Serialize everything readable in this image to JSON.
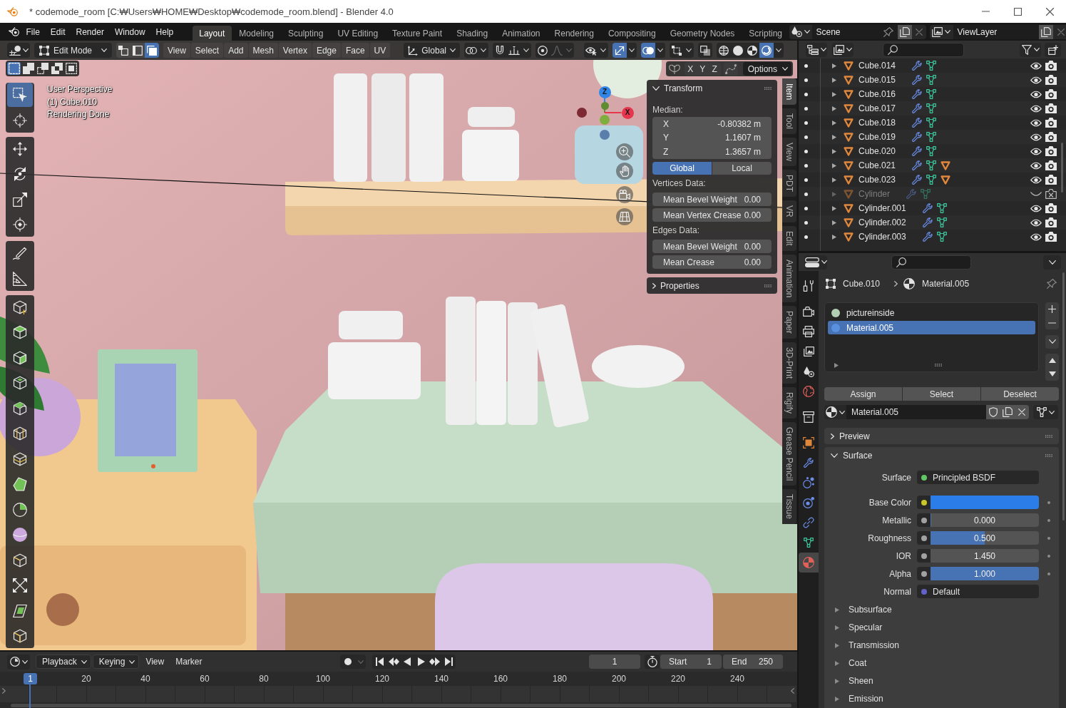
{
  "window": {
    "title": "* codemode_room [C:₩Users₩HOME₩Desktop₩codemode_room.blend] - Blender 4.0"
  },
  "menu_bar": {
    "menus": [
      "File",
      "Edit",
      "Render",
      "Window",
      "Help"
    ]
  },
  "workspace_tabs": [
    {
      "label": "Layout",
      "selected": true
    },
    {
      "label": "Modeling",
      "selected": false
    },
    {
      "label": "Sculpting",
      "selected": false
    },
    {
      "label": "UV Editing",
      "selected": false
    },
    {
      "label": "Texture Paint",
      "selected": false
    },
    {
      "label": "Shading",
      "selected": false
    },
    {
      "label": "Animation",
      "selected": false
    },
    {
      "label": "Rendering",
      "selected": false
    },
    {
      "label": "Compositing",
      "selected": false
    },
    {
      "label": "Geometry Nodes",
      "selected": false
    },
    {
      "label": "Scripting",
      "selected": false
    }
  ],
  "scene_selector": {
    "value": "Scene"
  },
  "view_layer_selector": {
    "value": "ViewLayer"
  },
  "viewport_header": {
    "mode": "Edit Mode",
    "select_modes": [
      {
        "kind": "vertex",
        "selected": false
      },
      {
        "kind": "edge",
        "selected": false
      },
      {
        "kind": "face",
        "selected": true
      }
    ],
    "menus": [
      "View",
      "Select",
      "Add",
      "Mesh",
      "Vertex",
      "Edge",
      "Face",
      "UV"
    ],
    "orientation": "Global",
    "toggle_groups": [
      [
        {
          "kind": "pivot",
          "on": false,
          "dropdown": true,
          "disabled": false
        }
      ],
      [
        {
          "kind": "snap",
          "on": false,
          "dropdown": false,
          "disabled": false
        },
        {
          "kind": "snap_target",
          "on": false,
          "dropdown": true,
          "disabled": false
        }
      ],
      [
        {
          "kind": "proportional",
          "on": false,
          "dropdown": false,
          "disabled": false
        },
        {
          "kind": "falloff",
          "on": false,
          "dropdown": true,
          "disabled": true
        }
      ],
      [
        {
          "kind": "selectability",
          "on": false,
          "dropdown": true,
          "disabled": false
        }
      ],
      [
        {
          "kind": "gizmos",
          "on": true,
          "dropdown": true,
          "disabled": false
        }
      ],
      [
        {
          "kind": "overlays",
          "on": true,
          "dropdown": true,
          "disabled": false
        }
      ],
      [
        {
          "kind": "mesh_overlays",
          "on": false,
          "dropdown": true,
          "disabled": false
        }
      ],
      [
        {
          "kind": "xray",
          "on": false,
          "dropdown": false,
          "disabled": false
        }
      ],
      [
        {
          "kind": "wireframe",
          "on": false,
          "dropdown": false,
          "disabled": false
        },
        {
          "kind": "solid",
          "on": false,
          "dropdown": false,
          "disabled": false
        },
        {
          "kind": "material_preview",
          "on": false,
          "dropdown": false,
          "disabled": false
        },
        {
          "kind": "rendered",
          "on": true,
          "dropdown": true,
          "disabled": false
        }
      ]
    ]
  },
  "tool_header": {
    "select_box_modes": [
      {
        "kind": "set",
        "selected": true
      },
      {
        "kind": "extend",
        "selected": false
      },
      {
        "kind": "subtract",
        "selected": false
      },
      {
        "kind": "difference",
        "selected": false
      },
      {
        "kind": "intersect",
        "selected": false
      }
    ],
    "mirror_axes": [
      {
        "label": "X",
        "on": false
      },
      {
        "label": "Y",
        "on": false
      },
      {
        "label": "Z",
        "on": false
      }
    ],
    "options": "Options"
  },
  "viewport_info": [
    "User Perspective",
    "(1) Cube.010",
    "Rendering Done"
  ],
  "toolbar": {
    "groups": [
      [
        {
          "kind": "select_box",
          "selected": true
        },
        {
          "kind": "cursor",
          "selected": false
        }
      ],
      [
        {
          "kind": "move",
          "selected": false
        },
        {
          "kind": "rotate",
          "selected": false
        },
        {
          "kind": "scale",
          "selected": false
        },
        {
          "kind": "transform",
          "selected": false
        }
      ],
      [
        {
          "kind": "annotate",
          "selected": false
        },
        {
          "kind": "measure",
          "selected": false
        }
      ],
      [
        {
          "kind": "add_cube",
          "selected": false
        },
        {
          "kind": "extrude_region",
          "selected": false
        },
        {
          "kind": "extrude_manifold",
          "selected": false
        },
        {
          "kind": "inset",
          "selected": false
        },
        {
          "kind": "bevel",
          "selected": false
        },
        {
          "kind": "loop_cut",
          "selected": false
        },
        {
          "kind": "knife",
          "selected": false
        },
        {
          "kind": "poly_build",
          "selected": false
        },
        {
          "kind": "spin",
          "selected": false
        },
        {
          "kind": "smooth",
          "selected": false
        },
        {
          "kind": "edge_slide",
          "selected": false
        },
        {
          "kind": "shrink_fatten",
          "selected": false
        },
        {
          "kind": "shear",
          "selected": false
        },
        {
          "kind": "rip_region",
          "selected": false
        }
      ]
    ]
  },
  "nav_gizmo": {
    "axes": [
      {
        "kind": "pos_z",
        "label": "Z",
        "color": "#2f86e6"
      },
      {
        "kind": "pos_y",
        "color": "#5f8c30"
      },
      {
        "kind": "pos_x",
        "label": "X",
        "color": "#e5364e"
      },
      {
        "kind": "neg_x",
        "color": "#7d2a35"
      },
      {
        "kind": "neg_y",
        "color": "#7fae3e"
      },
      {
        "kind": "neg_z",
        "color": "#5a7fab"
      }
    ],
    "buttons": [
      {
        "kind": "zoom"
      },
      {
        "kind": "pan"
      },
      {
        "kind": "camera"
      },
      {
        "kind": "ortho"
      }
    ]
  },
  "sidebar": {
    "panels": [
      {
        "title": "Transform",
        "expanded": true,
        "rows": [
          {
            "kind": "heading",
            "text": "Median:"
          },
          {
            "kind": "vector_component",
            "label": "X",
            "value": "-0.80382 m"
          },
          {
            "kind": "vector_component",
            "label": "Y",
            "value": "1.1607 m"
          },
          {
            "kind": "vector_component",
            "label": "Z",
            "value": "1.3657 m"
          },
          {
            "kind": "toggle",
            "options": [
              {
                "label": "Global",
                "selected": true
              },
              {
                "label": "Local",
                "selected": false
              }
            ]
          },
          {
            "kind": "heading",
            "text": "Vertices Data:"
          },
          {
            "kind": "value",
            "label": "Mean Bevel Weight",
            "value": "0.00"
          },
          {
            "kind": "value",
            "label": "Mean Vertex Crease",
            "value": "0.00"
          },
          {
            "kind": "heading",
            "text": "Edges Data:"
          },
          {
            "kind": "value",
            "label": "Mean Bevel Weight",
            "value": "0.00"
          },
          {
            "kind": "value",
            "label": "Mean Crease",
            "value": "0.00"
          }
        ]
      },
      {
        "title": "Properties",
        "expanded": false
      }
    ],
    "tabs": [
      {
        "label": "Item",
        "selected": true
      },
      {
        "label": "Tool",
        "selected": false
      },
      {
        "label": "View",
        "selected": false
      },
      {
        "label": "PDT",
        "selected": false
      },
      {
        "label": "VR",
        "selected": false
      },
      {
        "label": "Edit",
        "selected": false
      },
      {
        "label": "Animation",
        "selected": false
      },
      {
        "label": "Paper",
        "selected": false
      },
      {
        "label": "3D-Print",
        "selected": false
      },
      {
        "label": "Rigify",
        "selected": false
      },
      {
        "label": "Grease Pencil",
        "selected": false
      },
      {
        "label": "Tissue",
        "selected": false
      }
    ]
  },
  "outliner": {
    "rows": [
      {
        "name": "Cube.014",
        "visible": true,
        "renderable": true,
        "child_object": false
      },
      {
        "name": "Cube.015",
        "visible": true,
        "renderable": true,
        "child_object": false
      },
      {
        "name": "Cube.016",
        "visible": true,
        "renderable": true,
        "child_object": false
      },
      {
        "name": "Cube.017",
        "visible": true,
        "renderable": true,
        "child_object": false
      },
      {
        "name": "Cube.018",
        "visible": true,
        "renderable": true,
        "child_object": false
      },
      {
        "name": "Cube.019",
        "visible": true,
        "renderable": true,
        "child_object": false
      },
      {
        "name": "Cube.020",
        "visible": true,
        "renderable": true,
        "child_object": false
      },
      {
        "name": "Cube.021",
        "visible": true,
        "renderable": true,
        "child_object": true
      },
      {
        "name": "Cube.023",
        "visible": true,
        "renderable": true,
        "child_object": true
      },
      {
        "name": "Cylinder",
        "visible": false,
        "renderable": false,
        "child_object": false
      },
      {
        "name": "Cylinder.001",
        "visible": true,
        "renderable": true,
        "child_object": false
      },
      {
        "name": "Cylinder.002",
        "visible": true,
        "renderable": true,
        "child_object": false
      },
      {
        "name": "Cylinder.003",
        "visible": true,
        "renderable": true,
        "child_object": false
      }
    ]
  },
  "properties": {
    "tab_groups": [
      [
        {
          "kind": "tool",
          "selected": false
        }
      ],
      [
        {
          "kind": "render",
          "selected": false
        },
        {
          "kind": "output",
          "selected": false
        },
        {
          "kind": "view_layer",
          "selected": false
        },
        {
          "kind": "scene",
          "selected": false
        },
        {
          "kind": "world",
          "selected": false
        }
      ],
      [
        {
          "kind": "collection",
          "selected": false
        }
      ],
      [
        {
          "kind": "object",
          "selected": false
        },
        {
          "kind": "modifiers",
          "selected": false
        },
        {
          "kind": "particles",
          "selected": false
        },
        {
          "kind": "physics",
          "selected": false
        },
        {
          "kind": "constraints",
          "selected": false
        },
        {
          "kind": "data",
          "selected": false
        },
        {
          "kind": "material",
          "selected": true
        }
      ]
    ],
    "breadcrumb": {
      "object": "Cube.010",
      "material": "Material.005"
    },
    "material_slots": [
      {
        "name": "pictureinside",
        "color": "#b4d0b4",
        "selected": false
      },
      {
        "name": "Material.005",
        "color": "#5a90e0",
        "selected": true
      }
    ],
    "slot_actions": [
      "Assign",
      "Select",
      "Deselect"
    ],
    "material_name": "Material.005",
    "panels": [
      {
        "title": "Preview",
        "expanded": false
      },
      {
        "title": "Surface",
        "expanded": true,
        "inputs": [
          {
            "kind": "shader",
            "label": "Surface",
            "value": "Principled BSDF",
            "socket": {
              "color": "#63c763"
            }
          },
          {
            "kind": "color",
            "label": "Base Color",
            "socket": {
              "color": "#c7c729"
            },
            "swatch": {
              "color": "#2b7de9"
            }
          },
          {
            "kind": "slider",
            "label": "Metallic",
            "value": "0.000",
            "level": 0,
            "socket": {
              "color": "#a1a1a1"
            }
          },
          {
            "kind": "slider",
            "label": "Roughness",
            "value": "0.500",
            "level": 0.5,
            "socket": {
              "color": "#a1a1a1"
            }
          },
          {
            "kind": "number",
            "label": "IOR",
            "value": "1.450",
            "socket": {
              "color": "#a1a1a1"
            }
          },
          {
            "kind": "slider",
            "label": "Alpha",
            "value": "1.000",
            "level": 1,
            "socket": {
              "color": "#a1a1a1"
            }
          },
          {
            "kind": "vector",
            "label": "Normal",
            "value": "Default",
            "socket": {
              "color": "#6363c7"
            }
          }
        ],
        "subpanels": [
          {
            "title": "Subsurface",
            "expanded": false
          },
          {
            "title": "Specular",
            "expanded": false
          },
          {
            "title": "Transmission",
            "expanded": false
          },
          {
            "title": "Coat",
            "expanded": false
          },
          {
            "title": "Sheen",
            "expanded": false
          },
          {
            "title": "Emission",
            "expanded": false
          }
        ]
      }
    ]
  },
  "timeline": {
    "menus": [
      {
        "label": "Playback",
        "dropdown": true
      },
      {
        "label": "Keying",
        "dropdown": true
      },
      {
        "label": "View",
        "dropdown": false
      },
      {
        "label": "Marker",
        "dropdown": false
      }
    ],
    "auto_keying": false,
    "transport": [
      {
        "kind": "jump_start"
      },
      {
        "kind": "previous_keyframe"
      },
      {
        "kind": "play_reverse"
      },
      {
        "kind": "play"
      },
      {
        "kind": "next_keyframe"
      },
      {
        "kind": "jump_end"
      }
    ],
    "current_frame": "1",
    "start": {
      "label": "Start",
      "value": "1"
    },
    "end": {
      "label": "End",
      "value": "250"
    },
    "playhead": "1",
    "ruler": [
      "20",
      "40",
      "60",
      "80",
      "100",
      "120",
      "140",
      "160",
      "180",
      "200",
      "220",
      "240"
    ]
  }
}
